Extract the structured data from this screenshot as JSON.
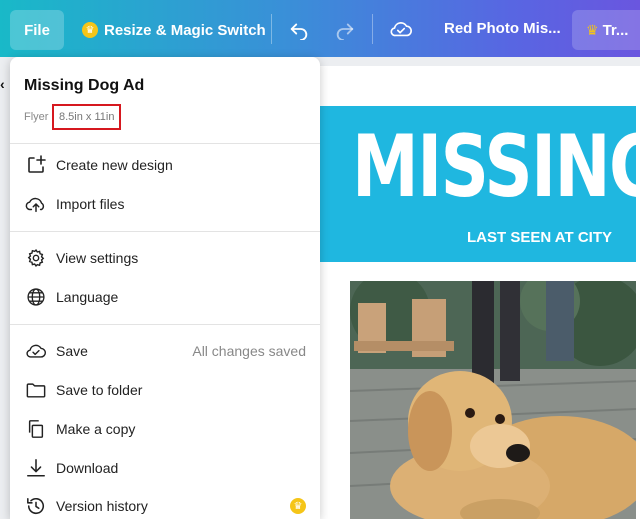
{
  "toolbar": {
    "file_label": "File",
    "resize_label": "Resize & Magic Switch",
    "design_title": "Red Photo Mis...",
    "try_label": "Tr..."
  },
  "canvas": {
    "left_stub": "‹",
    "headline": "MISSING",
    "subline": "LAST SEEN AT CITY"
  },
  "menu": {
    "title": "Missing Dog Ad",
    "type_label": "Flyer",
    "size_label": "8.5in x 11in",
    "items": [
      {
        "label": "Create new design",
        "icon": "plus-square-icon"
      },
      {
        "label": "Import files",
        "icon": "cloud-upload-icon"
      },
      {
        "label": "View settings",
        "icon": "gear-icon"
      },
      {
        "label": "Language",
        "icon": "globe-icon"
      },
      {
        "label": "Save",
        "icon": "cloud-check-icon",
        "status": "All changes saved"
      },
      {
        "label": "Save to folder",
        "icon": "folder-icon"
      },
      {
        "label": "Make a copy",
        "icon": "copy-icon"
      },
      {
        "label": "Download",
        "icon": "download-icon"
      },
      {
        "label": "Version history",
        "icon": "history-icon"
      }
    ]
  },
  "colors": {
    "accent_red": "#d6181f",
    "banner": "#1fb7e0",
    "crown": "#f5c518"
  }
}
